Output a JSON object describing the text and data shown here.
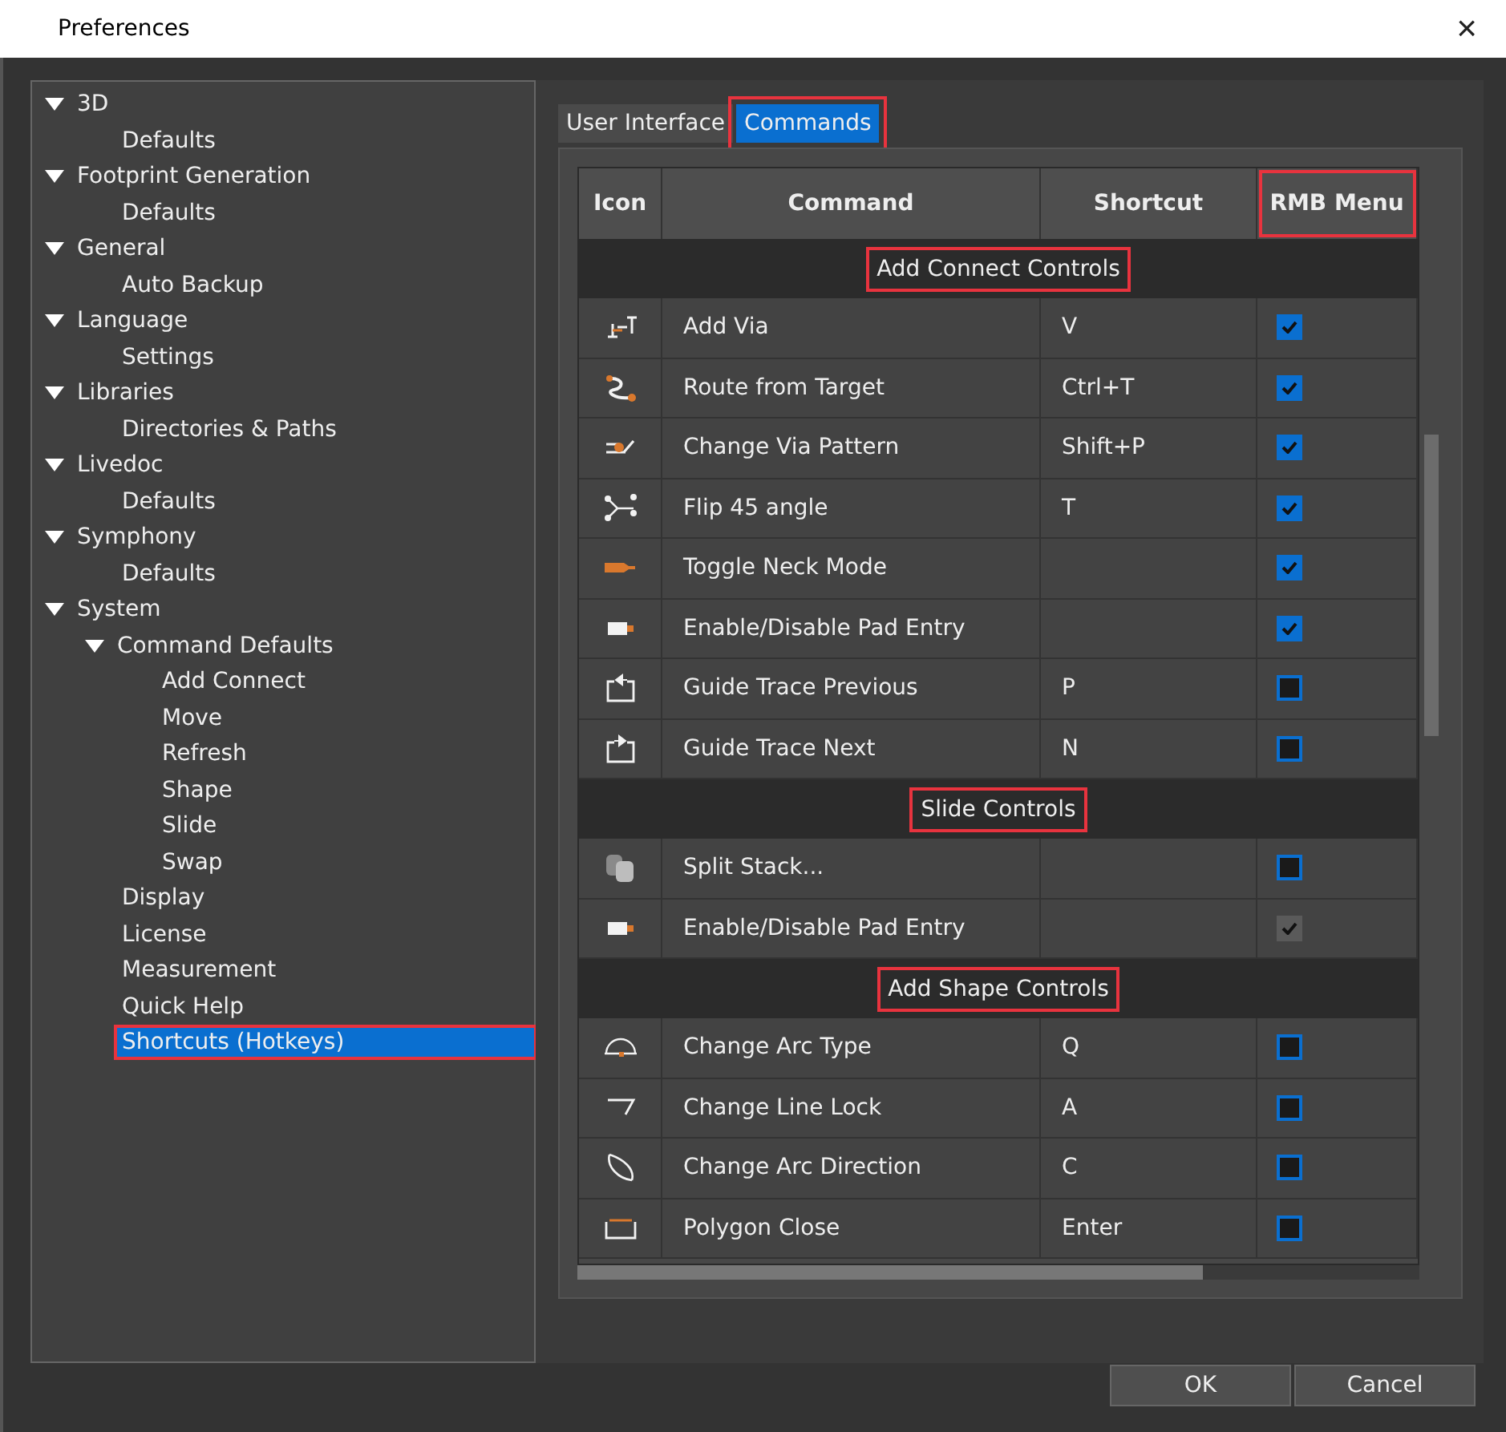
{
  "window": {
    "title": "Preferences",
    "close": "×"
  },
  "tree": [
    {
      "label": "3D",
      "expanded": true,
      "selected": false,
      "highlighted": false,
      "children": [
        {
          "label": "Defaults",
          "selected": false,
          "highlighted": false
        }
      ]
    },
    {
      "label": "Footprint Generation",
      "expanded": true,
      "selected": false,
      "highlighted": false,
      "children": [
        {
          "label": "Defaults",
          "selected": false,
          "highlighted": false
        }
      ]
    },
    {
      "label": "General",
      "expanded": true,
      "selected": false,
      "highlighted": false,
      "children": [
        {
          "label": "Auto Backup",
          "selected": false,
          "highlighted": false
        }
      ]
    },
    {
      "label": "Language",
      "expanded": true,
      "selected": false,
      "highlighted": false,
      "children": [
        {
          "label": "Settings",
          "selected": false,
          "highlighted": false
        }
      ]
    },
    {
      "label": "Libraries",
      "expanded": true,
      "selected": false,
      "highlighted": false,
      "children": [
        {
          "label": "Directories & Paths",
          "selected": false,
          "highlighted": false
        }
      ]
    },
    {
      "label": "Livedoc",
      "expanded": true,
      "selected": false,
      "highlighted": false,
      "children": [
        {
          "label": "Defaults",
          "selected": false,
          "highlighted": false
        }
      ]
    },
    {
      "label": "Symphony",
      "expanded": true,
      "selected": false,
      "highlighted": false,
      "children": [
        {
          "label": "Defaults",
          "selected": false,
          "highlighted": false
        }
      ]
    },
    {
      "label": "System",
      "expanded": true,
      "selected": false,
      "highlighted": false,
      "children": [
        {
          "label": "Command Defaults",
          "expanded": true,
          "selected": false,
          "highlighted": false,
          "children": [
            {
              "label": "Add Connect",
              "selected": false,
              "highlighted": false
            },
            {
              "label": "Move",
              "selected": false,
              "highlighted": false
            },
            {
              "label": "Refresh",
              "selected": false,
              "highlighted": false
            },
            {
              "label": "Shape",
              "selected": false,
              "highlighted": false
            },
            {
              "label": "Slide",
              "selected": false,
              "highlighted": false
            },
            {
              "label": "Swap",
              "selected": false,
              "highlighted": false
            }
          ]
        },
        {
          "label": "Display",
          "selected": false,
          "highlighted": false
        },
        {
          "label": "License",
          "selected": false,
          "highlighted": false
        },
        {
          "label": "Measurement",
          "selected": false,
          "highlighted": false
        },
        {
          "label": "Quick Help",
          "selected": false,
          "highlighted": false
        },
        {
          "label": "Shortcuts (Hotkeys)",
          "selected": true,
          "highlighted": true
        }
      ]
    }
  ],
  "tabs": [
    {
      "label": "User Interface",
      "selected": false,
      "highlighted": false
    },
    {
      "label": "Commands",
      "selected": true,
      "highlighted": true
    }
  ],
  "table": {
    "columns": [
      {
        "label": "Icon",
        "highlighted": false
      },
      {
        "label": "Command",
        "highlighted": false
      },
      {
        "label": "Shortcut",
        "highlighted": false
      },
      {
        "label": "RMB Menu",
        "highlighted": true
      }
    ],
    "groups": [
      {
        "title": "Add Connect Controls",
        "highlighted": true,
        "rows": [
          {
            "kind": "via",
            "command": "Add Via",
            "shortcut": "V",
            "checked": true,
            "disabled": false
          },
          {
            "kind": "route",
            "command": "Route from Target",
            "shortcut": "Ctrl+T",
            "checked": true,
            "disabled": false
          },
          {
            "kind": "pattern",
            "command": "Change Via Pattern",
            "shortcut": "Shift+P",
            "checked": true,
            "disabled": false
          },
          {
            "kind": "flip",
            "command": "Flip 45 angle",
            "shortcut": "T",
            "checked": true,
            "disabled": false
          },
          {
            "kind": "neck",
            "command": "Toggle Neck Mode",
            "shortcut": "",
            "checked": true,
            "disabled": false
          },
          {
            "kind": "pad",
            "command": "Enable/Disable Pad Entry",
            "shortcut": "",
            "checked": true,
            "disabled": false
          },
          {
            "kind": "prev",
            "command": "Guide Trace Previous",
            "shortcut": "P",
            "checked": false,
            "disabled": false
          },
          {
            "kind": "next",
            "command": "Guide Trace Next",
            "shortcut": "N",
            "checked": false,
            "disabled": false
          }
        ]
      },
      {
        "title": "Slide Controls",
        "highlighted": true,
        "rows": [
          {
            "kind": "stack",
            "command": "Split Stack...",
            "shortcut": "",
            "checked": false,
            "disabled": false
          },
          {
            "kind": "pad",
            "command": "Enable/Disable Pad Entry",
            "shortcut": "",
            "checked": true,
            "disabled": true
          }
        ]
      },
      {
        "title": "Add Shape Controls",
        "highlighted": true,
        "rows": [
          {
            "kind": "arc",
            "command": "Change Arc Type",
            "shortcut": "Q",
            "checked": false,
            "disabled": false
          },
          {
            "kind": "lock",
            "command": "Change Line Lock",
            "shortcut": "A",
            "checked": false,
            "disabled": false
          },
          {
            "kind": "direction",
            "command": "Change Arc Direction",
            "shortcut": "C",
            "checked": false,
            "disabled": false
          },
          {
            "kind": "polygon",
            "command": "Polygon Close",
            "shortcut": "Enter",
            "checked": false,
            "disabled": false
          }
        ]
      }
    ]
  },
  "buttons": [
    {
      "label": "OK"
    },
    {
      "label": "Cancel"
    }
  ]
}
